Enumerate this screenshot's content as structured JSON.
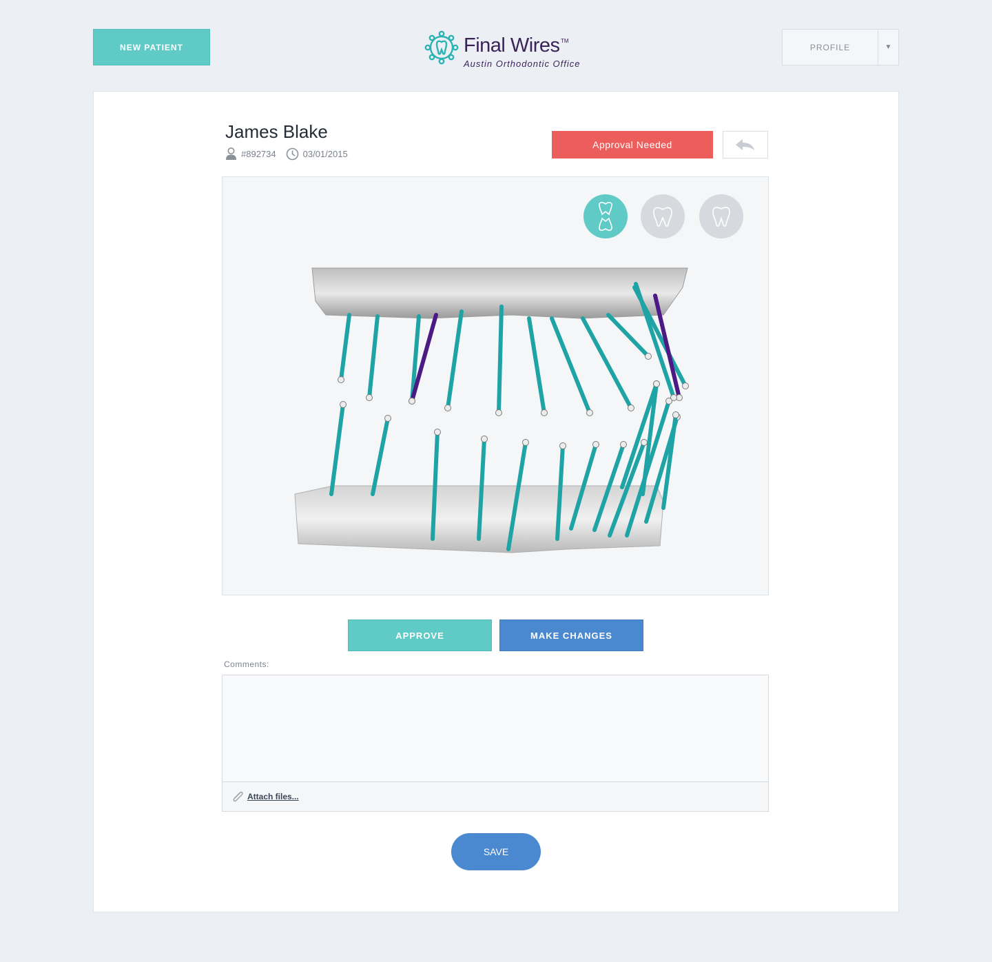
{
  "header": {
    "new_patient_label": "NEW PATIENT",
    "logo_title": "Final Wires",
    "logo_tm": "TM",
    "logo_subtitle": "Austin Orthodontic Office",
    "profile_label": "PROFILE"
  },
  "patient": {
    "name": "James Blake",
    "id": "#892734",
    "date": "03/01/2015",
    "status": "Approval Needed"
  },
  "viewer": {
    "views": [
      {
        "name": "both-arches-view",
        "active": true
      },
      {
        "name": "upper-arch-view",
        "active": false
      },
      {
        "name": "single-tooth-view",
        "active": false
      }
    ]
  },
  "actions": {
    "approve_label": "APPROVE",
    "make_changes_label": "MAKE CHANGES",
    "save_label": "SAVE"
  },
  "comments": {
    "label": "Comments:",
    "value": "",
    "attach_label": "Attach files..."
  },
  "colors": {
    "teal": "#5fcac6",
    "blue": "#4a88cf",
    "alert": "#ec5e5c",
    "wire": "#1fa3a4",
    "wire_highlight": "#4b1a84",
    "brand_text": "#3b2359"
  }
}
